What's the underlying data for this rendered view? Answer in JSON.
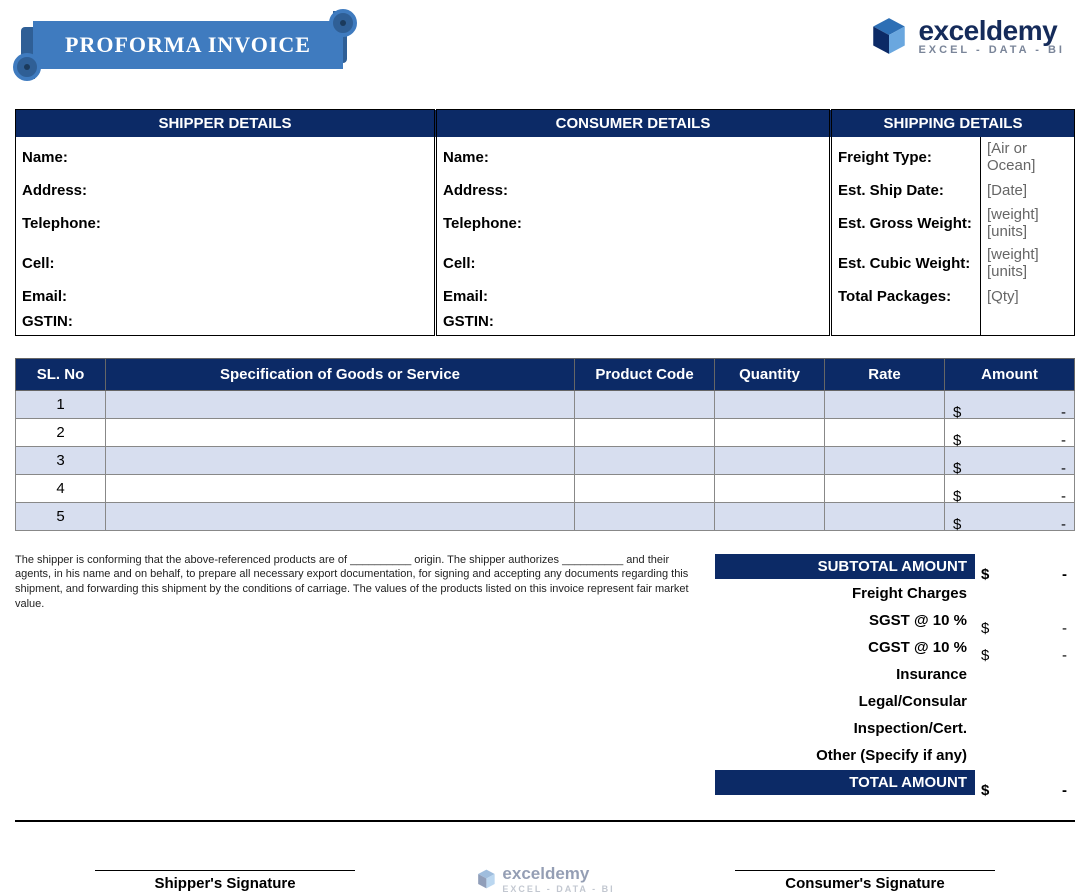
{
  "title": "PROFORMA INVOICE",
  "brand": {
    "name": "exceldemy",
    "tag": "EXCEL - DATA - BI"
  },
  "sections": {
    "shipper": {
      "heading": "SHIPPER DETAILS",
      "fields": [
        {
          "label": "Name:",
          "value": ""
        },
        {
          "label": "Address:",
          "value": ""
        },
        {
          "label": "Telephone:",
          "value": ""
        },
        {
          "label": "Cell:",
          "value": ""
        },
        {
          "label": "Email:",
          "value": ""
        },
        {
          "label": "GSTIN:",
          "value": ""
        }
      ]
    },
    "consumer": {
      "heading": "CONSUMER DETAILS",
      "fields": [
        {
          "label": "Name:",
          "value": ""
        },
        {
          "label": "Address:",
          "value": ""
        },
        {
          "label": "Telephone:",
          "value": ""
        },
        {
          "label": "Cell:",
          "value": ""
        },
        {
          "label": "Email:",
          "value": ""
        },
        {
          "label": "GSTIN:",
          "value": ""
        }
      ]
    },
    "shipping": {
      "heading": "SHIPPING DETAILS",
      "fields": [
        {
          "label": "Freight Type:",
          "value": "[Air or Ocean]"
        },
        {
          "label": "Est. Ship Date:",
          "value": "[Date]"
        },
        {
          "label": "Est. Gross Weight:",
          "value": "[weight] [units]"
        },
        {
          "label": "Est. Cubic Weight:",
          "value": "[weight] [units]"
        },
        {
          "label": "Total Packages:",
          "value": "[Qty]"
        },
        {
          "label": "",
          "value": ""
        }
      ]
    }
  },
  "items": {
    "headers": [
      "SL. No",
      "Specification of Goods or Service",
      "Product Code",
      "Quantity",
      "Rate",
      "Amount"
    ],
    "rows": [
      {
        "sl": "1",
        "spec": "",
        "code": "",
        "qty": "",
        "rate": "",
        "amount_cur": "$",
        "amount_val": "-"
      },
      {
        "sl": "2",
        "spec": "",
        "code": "",
        "qty": "",
        "rate": "",
        "amount_cur": "$",
        "amount_val": "-"
      },
      {
        "sl": "3",
        "spec": "",
        "code": "",
        "qty": "",
        "rate": "",
        "amount_cur": "$",
        "amount_val": "-"
      },
      {
        "sl": "4",
        "spec": "",
        "code": "",
        "qty": "",
        "rate": "",
        "amount_cur": "$",
        "amount_val": "-"
      },
      {
        "sl": "5",
        "spec": "",
        "code": "",
        "qty": "",
        "rate": "",
        "amount_cur": "$",
        "amount_val": "-"
      }
    ]
  },
  "declaration": "The shipper is conforming that the above-referenced products are of __________ origin. The shipper authorizes __________ and their agents, in his name and on behalf, to prepare all necessary export documentation, for signing and accepting any documents regarding this shipment, and forwarding this shipment by the conditions of carriage. The values of the products listed on this invoice represent fair market value.",
  "totals": {
    "subtotal": {
      "label": "SUBTOTAL AMOUNT",
      "cur": "$",
      "val": "-"
    },
    "lines": [
      {
        "label": "Freight Charges",
        "cur": "",
        "val": ""
      },
      {
        "label": "SGST @ 10 %",
        "cur": "$",
        "val": "-"
      },
      {
        "label": "CGST @ 10 %",
        "cur": "$",
        "val": "-"
      },
      {
        "label": "Insurance",
        "cur": "",
        "val": ""
      },
      {
        "label": "Legal/Consular",
        "cur": "",
        "val": ""
      },
      {
        "label": "Inspection/Cert.",
        "cur": "",
        "val": ""
      },
      {
        "label": "Other (Specify if any)",
        "cur": "",
        "val": ""
      }
    ],
    "total": {
      "label": "TOTAL AMOUNT",
      "cur": "$",
      "val": "-"
    }
  },
  "signatures": {
    "shipper": "Shipper's Signature",
    "consumer": "Consumer's Signature"
  }
}
